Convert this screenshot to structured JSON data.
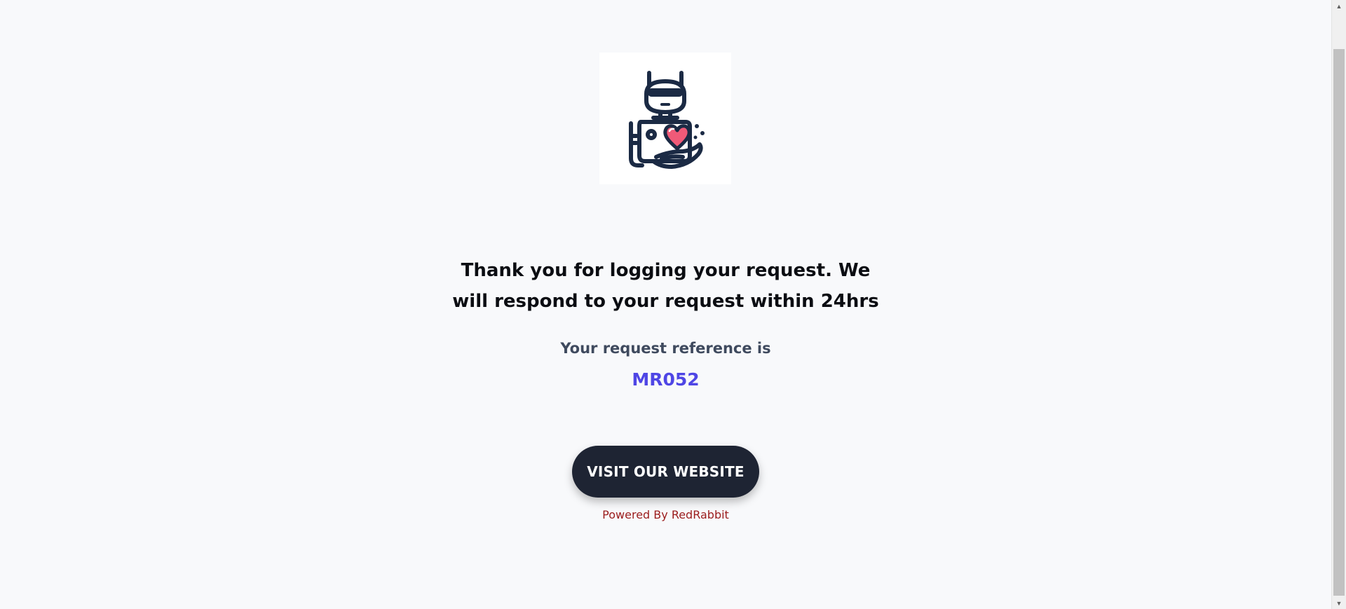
{
  "logo": {
    "icon": "robot-holding-heart-icon",
    "colors": {
      "outline": "#1b2a44",
      "heart": "#f05a78",
      "face": "#ffffff"
    }
  },
  "message": {
    "line1": "Thank you for logging your request. We",
    "line2": "will respond to your request within 24hrs"
  },
  "reference": {
    "label": "Your request reference is",
    "code": "MR052"
  },
  "cta": {
    "label": "VISIT OUR WEBSITE"
  },
  "footer": {
    "powered_by": "Powered By RedRabbit"
  },
  "scrollbar": {
    "up_icon": "▲",
    "down_icon": "▼"
  },
  "colors": {
    "background": "#f8f9fb",
    "accent": "#4f46e5",
    "button": "#1e2433",
    "powered_text": "#9b1c1c"
  }
}
